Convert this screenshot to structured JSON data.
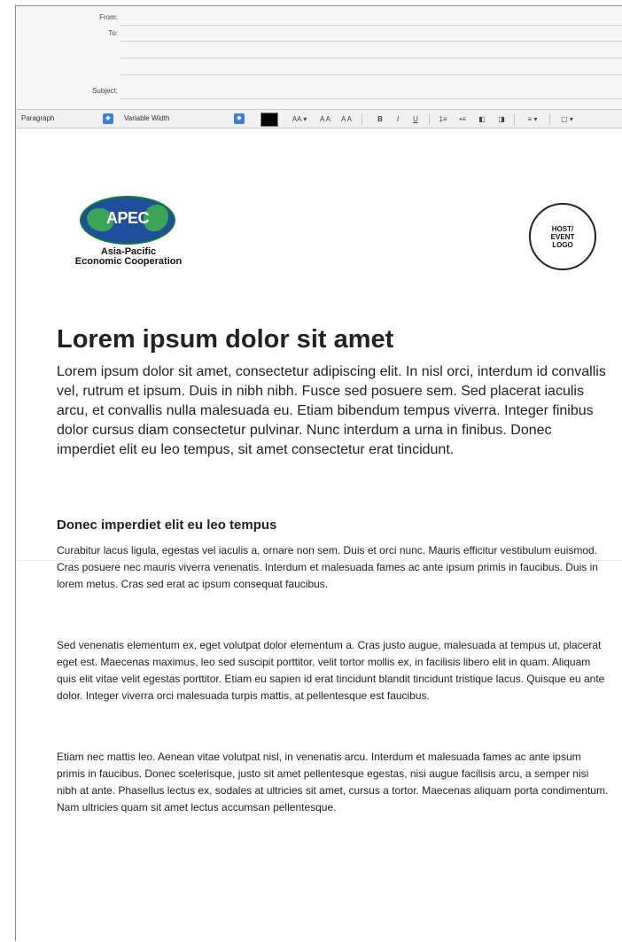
{
  "compose": {
    "from_label": "From:",
    "to_label": "To:",
    "subject_label": "Subject:"
  },
  "toolbar": {
    "paragraph_style": "Paragraph",
    "font": "Variable Width",
    "font_size_dropdown": "AA ▾",
    "smaller_label": "A A",
    "larger_label": "A A",
    "bold": "B",
    "italic": "I",
    "underline": "U",
    "ordered_list": "1≡",
    "bullet_list": "•≡",
    "outdent": "◧",
    "indent": "◨",
    "align": "≡ ▾",
    "insert": "▢ ▾",
    "text_color": "#000000"
  },
  "content": {
    "apec_wordmark": "APEC",
    "apec_caption_line1": "Asia-Pacific",
    "apec_caption_line2": "Economic Cooperation",
    "host_logo": [
      "HOST/",
      "EVENT",
      "LOGO"
    ],
    "heading": "Lorem ipsum dolor sit amet",
    "lead": "Lorem ipsum dolor sit amet, consectetur adipiscing elit. In nisl orci, interdum id convallis vel, rutrum et ipsum. Duis in nibh nibh. Fusce sed posuere sem. Sed placerat iaculis arcu, et convallis nulla malesuada eu. Etiam bibendum tempus viverra. Integer finibus dolor cursus diam consectetur pulvinar. Nunc interdum a urna in finibus. Donec imperdiet elit eu leo tempus, sit amet consectetur erat tincidunt.",
    "subheading": "Donec imperdiet elit eu leo tempus",
    "paragraphs": [
      "Curabitur lacus ligula, egestas vel iaculis a, ornare non sem. Duis et orci nunc. Mauris efficitur vestibulum euismod. Cras posuere nec mauris viverra venenatis. Interdum et malesuada fames ac ante ipsum primis in faucibus. Duis in lorem metus. Cras sed erat ac ipsum consequat faucibus.",
      "Sed venenatis elementum ex, eget volutpat dolor elementum a. Cras justo augue, malesuada at tempus ut, placerat eget est. Maecenas maximus, leo sed suscipit porttitor, velit tortor mollis ex, in facilisis libero elit in quam. Aliquam quis elit vitae velit egestas porttitor. Etiam eu sapien id erat tincidunt blandit tincidunt tristique lacus. Quisque eu ante dolor. Integer viverra orci malesuada turpis mattis, at pellentesque est faucibus.",
      "Etiam nec mattis leo. Aenean vitae volutpat nisl, in venenatis arcu. Interdum et malesuada fames ac ante ipsum primis in faucibus. Donec scelerisque, justo sit amet pellentesque egestas, nisi augue facilisis arcu, a semper nisi nibh at ante. Phasellus lectus ex, sodales at ultricies sit amet, cursus a tortor. Maecenas aliquam porta condimentum. Nam ultricies quam sit amet lectus accumsan pellentesque."
    ]
  }
}
